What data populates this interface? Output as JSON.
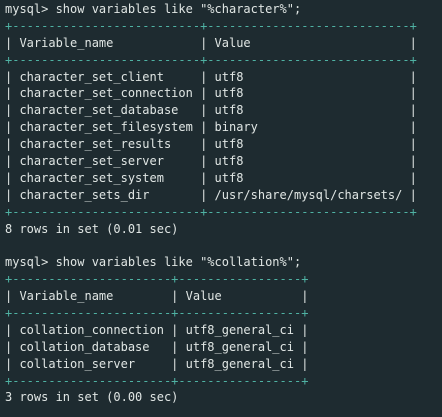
{
  "session": [
    {
      "type": "cmd",
      "text": "mysql> show variables like \"%character%\";"
    },
    {
      "type": "border",
      "text": "+--------------------------+----------------------------+"
    },
    {
      "type": "row",
      "text": "| Variable_name            | Value                      |"
    },
    {
      "type": "border",
      "text": "+--------------------------+----------------------------+"
    },
    {
      "type": "row",
      "text": "| character_set_client     | utf8                       |"
    },
    {
      "type": "row",
      "text": "| character_set_connection | utf8                       |"
    },
    {
      "type": "row",
      "text": "| character_set_database   | utf8                       |"
    },
    {
      "type": "row",
      "text": "| character_set_filesystem | binary                     |"
    },
    {
      "type": "row",
      "text": "| character_set_results    | utf8                       |"
    },
    {
      "type": "row",
      "text": "| character_set_server     | utf8                       |"
    },
    {
      "type": "row",
      "text": "| character_set_system     | utf8                       |"
    },
    {
      "type": "row",
      "text": "| character_sets_dir       | /usr/share/mysql/charsets/ |"
    },
    {
      "type": "border",
      "text": "+--------------------------+----------------------------+"
    },
    {
      "type": "status",
      "text": "8 rows in set (0.01 sec)"
    },
    {
      "type": "blank",
      "text": ""
    },
    {
      "type": "cmd",
      "text": "mysql> show variables like \"%collation%\";"
    },
    {
      "type": "border",
      "text": "+----------------------+-----------------+"
    },
    {
      "type": "row",
      "text": "| Variable_name        | Value           |"
    },
    {
      "type": "border",
      "text": "+----------------------+-----------------+"
    },
    {
      "type": "row",
      "text": "| collation_connection | utf8_general_ci |"
    },
    {
      "type": "row",
      "text": "| collation_database   | utf8_general_ci |"
    },
    {
      "type": "row",
      "text": "| collation_server     | utf8_general_ci |"
    },
    {
      "type": "border",
      "text": "+----------------------+-----------------+"
    },
    {
      "type": "status",
      "text": "3 rows in set (0.00 sec)"
    }
  ]
}
